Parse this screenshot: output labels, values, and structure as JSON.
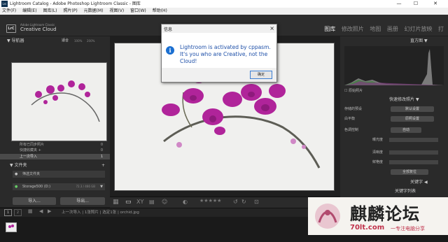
{
  "titlebar": {
    "logo": "Lrc",
    "title": "Lightroom Catalog - Adobe Photoshop Lightroom Classic - 图库",
    "min": "—",
    "max": "☐",
    "close": "✕"
  },
  "menu": [
    "文件(F)",
    "编辑(E)",
    "图库(L)",
    "照片(P)",
    "元数据(M)",
    "视图(V)",
    "窗口(W)",
    "帮助(H)"
  ],
  "identity": {
    "logo": "LrC",
    "line1": "Adobe Lightroom Classic",
    "line2": "Creative Cloud",
    "modules": [
      "图库",
      "修改照片",
      "地图",
      "画册",
      "幻灯片放映",
      "打"
    ]
  },
  "left": {
    "navigator": "导航器",
    "fit": "适合",
    "p100": "100%",
    "p200": "200%",
    "catalog_rows": [
      {
        "label": "所有已同步照片",
        "count": "0"
      },
      {
        "label": "快捷收藏夹 +",
        "count": "0"
      },
      {
        "label": "上一次导入",
        "count": "1"
      }
    ],
    "folders": "文件夹",
    "filter": "筛选文件夹",
    "drive": "Storage500 (D:)",
    "drive_info": "72.3 / 466 GB",
    "import_btn": "导入...",
    "export_btn": "导出..."
  },
  "right": {
    "histogram": "直方图",
    "orig_photo": "原始照片",
    "quick_develop": "快速修改照片",
    "saved_preset": "存储的预设",
    "saved_value": "默认设置",
    "white_balance": "白平衡",
    "wb_value": "原照设置",
    "tone_control": "色调控制",
    "auto": "自动",
    "exposure": "曝光度",
    "clarity": "清晰度",
    "vibrance": "鲜艳度",
    "reset": "全部复位",
    "keywords": "关键字",
    "keyword_list": "关键字列表"
  },
  "filmstrip_bar": {
    "p1": "1",
    "p2": "2",
    "path": "上一次导入 | 1张照片 | 选定1张 | orchid.jpg"
  },
  "dialog": {
    "title": "信息",
    "message": "Lightroom is activated by cppasm. It's you who are Creative, not the Cloud!",
    "ok": "确定",
    "icon": "i"
  },
  "watermark": {
    "name": "麒麟论坛",
    "url": "70lt.com",
    "slogan": "一专注电脑分享"
  },
  "colors": {
    "accent": "#1a6fd1",
    "orchid": "#b0249a"
  }
}
